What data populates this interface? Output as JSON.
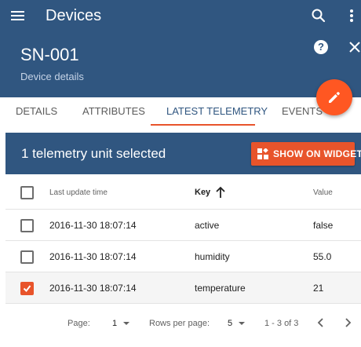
{
  "app": {
    "title": "Devices",
    "menu_icon": "menu-icon",
    "search_icon": "search-icon",
    "more_icon": "more-vert-icon"
  },
  "device": {
    "name": "SN-001",
    "subtitle": "Device details",
    "help_icon": "help-icon",
    "close_icon": "close-icon",
    "edit_icon": "edit-icon"
  },
  "tabs": [
    {
      "label": "DETAILS",
      "active": false
    },
    {
      "label": "ATTRIBUTES",
      "active": false
    },
    {
      "label": "LATEST TELEMETRY",
      "active": true
    },
    {
      "label": "EVENTS",
      "active": false
    }
  ],
  "toolbar": {
    "selection_text": "1 telemetry unit selected",
    "widget_button": "SHOW ON WIDGET",
    "widget_icon": "widgets-icon"
  },
  "table": {
    "columns": [
      "Last update time",
      "Key",
      "Value"
    ],
    "sort": {
      "column": "Key",
      "direction": "ascending",
      "icon": "arrow-up-icon"
    },
    "rows": [
      {
        "time": "2016-11-30 18:07:14",
        "key": "active",
        "value": "false",
        "selected": false
      },
      {
        "time": "2016-11-30 18:07:14",
        "key": "humidity",
        "value": "55.0",
        "selected": false
      },
      {
        "time": "2016-11-30 18:07:14",
        "key": "temperature",
        "value": "21",
        "selected": true
      }
    ]
  },
  "pagination": {
    "page_label": "Page:",
    "page_value": "1",
    "rows_label": "Rows per page:",
    "rows_value": "5",
    "range": "1 - 3 of 3",
    "prev_icon": "chevron-left-icon",
    "next_icon": "chevron-right-icon"
  },
  "colors": {
    "primary": "#305680",
    "accent": "#e8542b",
    "fab": "#ff5722"
  }
}
